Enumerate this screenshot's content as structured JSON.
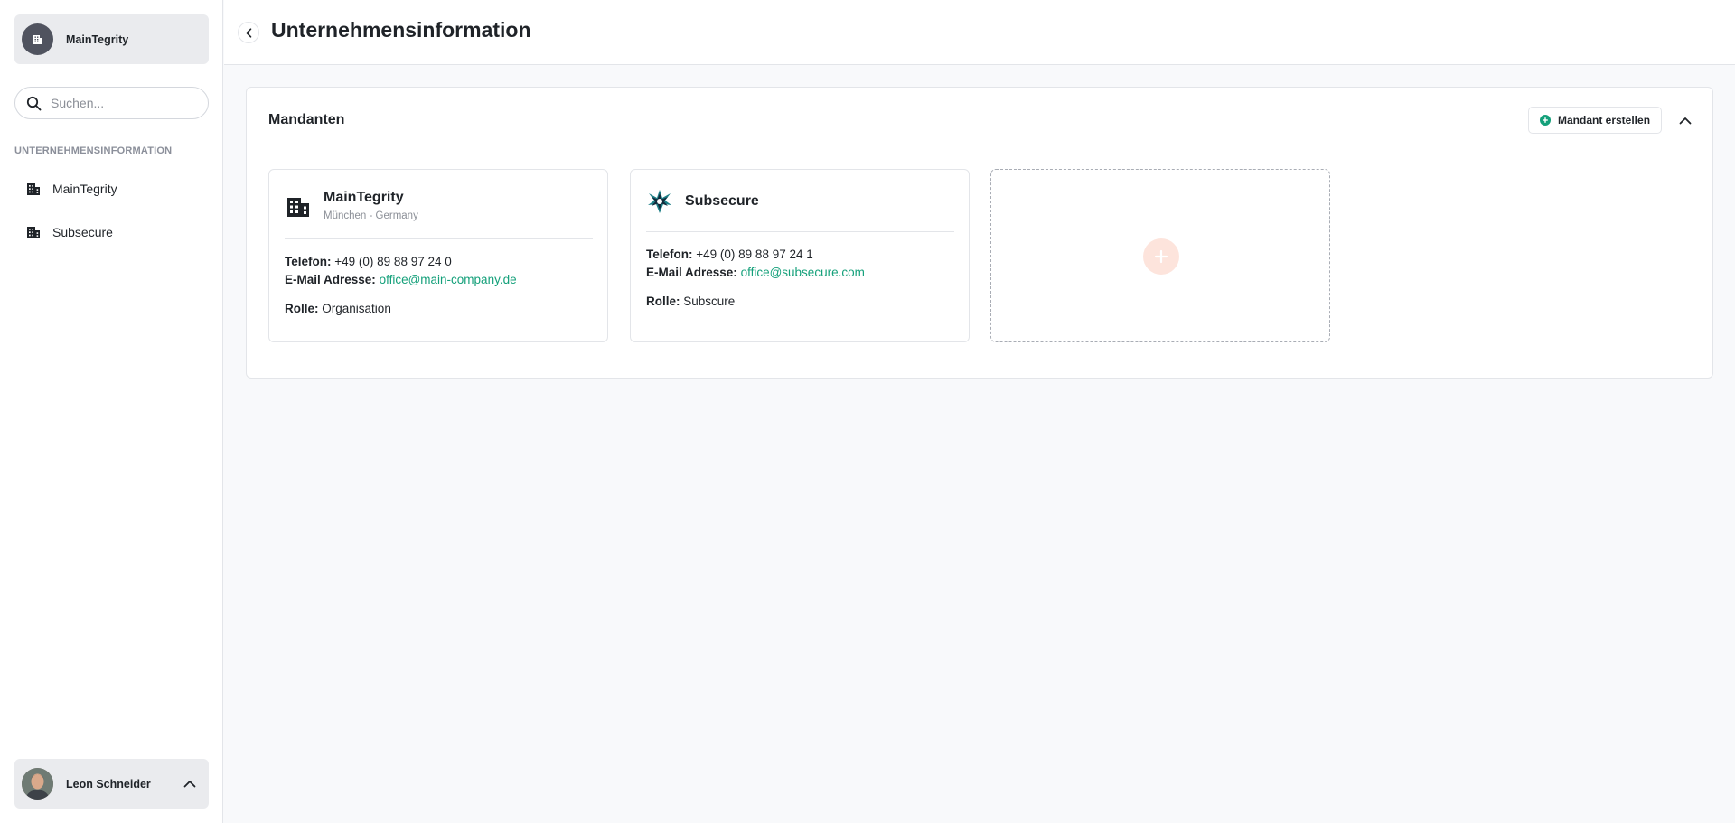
{
  "sidebar": {
    "org_name": "MainTegrity",
    "search_placeholder": "Suchen...",
    "section_heading": "UNTERNEHMENSINFORMATION",
    "items": [
      {
        "label": "MainTegrity"
      },
      {
        "label": "Subsecure"
      }
    ],
    "user_name": "Leon Schneider"
  },
  "header": {
    "title": "Unternehmensinformation"
  },
  "panel": {
    "title": "Mandanten",
    "create_label": "Mandant erstellen"
  },
  "cards": [
    {
      "name": "MainTegrity",
      "location": "München - Germany",
      "phone_label": "Telefon:",
      "phone": "+49 (0) 89 88 97 24 0",
      "email_label": "E-Mail Adresse:",
      "email": "office@main-company.de",
      "role_label": "Rolle:",
      "role": "Organisation"
    },
    {
      "name": "Subsecure",
      "phone_label": "Telefon:",
      "phone": "+49 (0) 89 88 97 24 1",
      "email_label": "E-Mail Adresse:",
      "email": "office@subsecure.com",
      "role_label": "Rolle:",
      "role": "Subscure"
    }
  ],
  "colors": {
    "accent": "#14a07a",
    "add_circle": "#fde4dc",
    "sidebar_box": "#eaebee"
  }
}
